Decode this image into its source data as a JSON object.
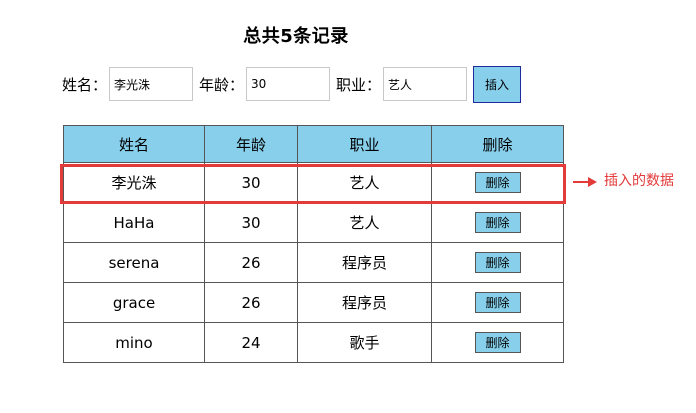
{
  "header": {
    "title": "总共5条记录"
  },
  "form": {
    "name_label": "姓名：",
    "name_value": "李光洙",
    "age_label": "年龄：",
    "age_value": "30",
    "job_label": "职业：",
    "job_value": "艺人",
    "insert_label": "插入"
  },
  "table": {
    "headers": [
      "姓名",
      "年龄",
      "职业",
      "删除"
    ],
    "delete_label": "删除",
    "rows": [
      {
        "name": "李光洙",
        "age": "30",
        "job": "艺人"
      },
      {
        "name": "HaHa",
        "age": "30",
        "job": "艺人"
      },
      {
        "name": "serena",
        "age": "26",
        "job": "程序员"
      },
      {
        "name": "grace",
        "age": "26",
        "job": "程序员"
      },
      {
        "name": "mino",
        "age": "24",
        "job": "歌手"
      }
    ]
  },
  "annotation": {
    "text": "插入的数据",
    "color": "#e33a3a"
  },
  "colors": {
    "header_bg": "#87cfeb",
    "button_bg": "#87cfeb",
    "insert_border": "#1e2b9c"
  }
}
